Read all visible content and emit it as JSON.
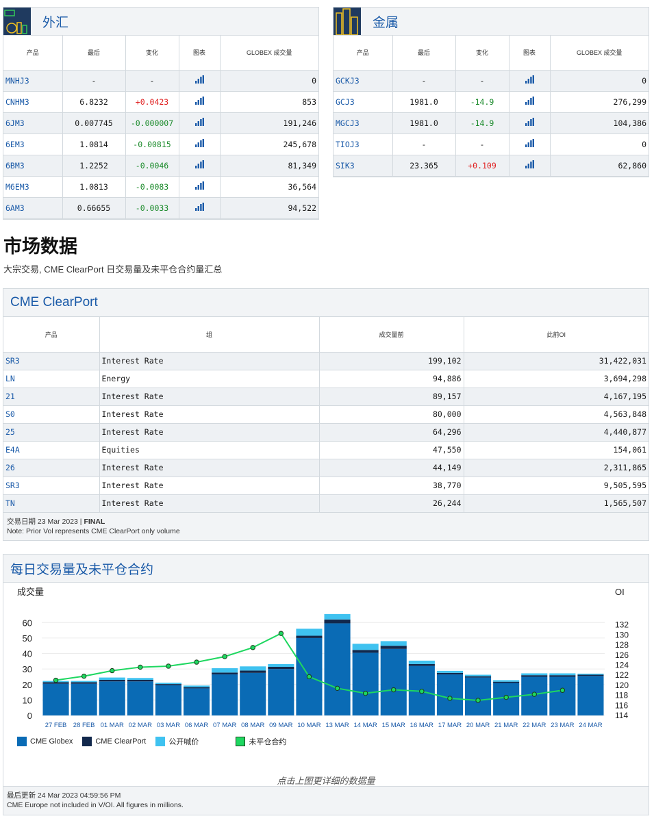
{
  "fx": {
    "title": "外汇",
    "headers": [
      "产品",
      "最后",
      "变化",
      "图表",
      "GLOBEX 成交量"
    ],
    "rows": [
      {
        "sym": "MNHJ3",
        "last": "-",
        "chg": "-",
        "dir": "none",
        "vol": "0"
      },
      {
        "sym": "CNHM3",
        "last": "6.8232",
        "chg": "+0.0423",
        "dir": "pos",
        "vol": "853"
      },
      {
        "sym": "6JM3",
        "last": "0.007745",
        "chg": "-0.000007",
        "dir": "neg",
        "vol": "191,246"
      },
      {
        "sym": "6EM3",
        "last": "1.0814",
        "chg": "-0.00815",
        "dir": "neg",
        "vol": "245,678"
      },
      {
        "sym": "6BM3",
        "last": "1.2252",
        "chg": "-0.0046",
        "dir": "neg",
        "vol": "81,349"
      },
      {
        "sym": "M6EM3",
        "last": "1.0813",
        "chg": "-0.0083",
        "dir": "neg",
        "vol": "36,564"
      },
      {
        "sym": "6AM3",
        "last": "0.66655",
        "chg": "-0.0033",
        "dir": "neg",
        "vol": "94,522"
      }
    ]
  },
  "metals": {
    "title": "金属",
    "headers": [
      "产品",
      "最后",
      "变化",
      "图表",
      "GLOBEX 成交量"
    ],
    "rows": [
      {
        "sym": "GCKJ3",
        "last": "-",
        "chg": "-",
        "dir": "none",
        "vol": "0"
      },
      {
        "sym": "GCJ3",
        "last": "1981.0",
        "chg": "-14.9",
        "dir": "neg",
        "vol": "276,299"
      },
      {
        "sym": "MGCJ3",
        "last": "1981.0",
        "chg": "-14.9",
        "dir": "neg",
        "vol": "104,386"
      },
      {
        "sym": "TIOJ3",
        "last": "-",
        "chg": "-",
        "dir": "none",
        "vol": "0"
      },
      {
        "sym": "SIK3",
        "last": "23.365",
        "chg": "+0.109",
        "dir": "pos",
        "vol": "62,860"
      }
    ]
  },
  "market": {
    "title": "市场数据",
    "subtitle": "大宗交易, CME ClearPort 日交易量及未平仓合约量汇总"
  },
  "clearport": {
    "title": "CME ClearPort",
    "headers": [
      "产品",
      "组",
      "成交量前",
      "此前OI"
    ],
    "rows": [
      {
        "sym": "SR3",
        "group": "Interest Rate",
        "vol": "199,102",
        "oi": "31,422,031"
      },
      {
        "sym": "LN",
        "group": "Energy",
        "vol": "94,886",
        "oi": "3,694,298"
      },
      {
        "sym": "21",
        "group": "Interest Rate",
        "vol": "89,157",
        "oi": "4,167,195"
      },
      {
        "sym": "S0",
        "group": "Interest Rate",
        "vol": "80,000",
        "oi": "4,563,848"
      },
      {
        "sym": "25",
        "group": "Interest Rate",
        "vol": "64,296",
        "oi": "4,440,877"
      },
      {
        "sym": "E4A",
        "group": "Equities",
        "vol": "47,550",
        "oi": "154,061"
      },
      {
        "sym": "26",
        "group": "Interest Rate",
        "vol": "44,149",
        "oi": "2,311,865"
      },
      {
        "sym": "SR3",
        "group": "Interest Rate",
        "vol": "38,770",
        "oi": "9,505,595"
      },
      {
        "sym": "TN",
        "group": "Interest Rate",
        "vol": "26,244",
        "oi": "1,565,507"
      }
    ],
    "foot_date_prefix": "交易日期 23 Mar 2023 | ",
    "foot_status": "FINAL",
    "foot_note": "Note: Prior Vol represents CME ClearPort only volume"
  },
  "daily": {
    "title": "每日交易量及未平仓合约",
    "hint": "点击上图更详细的数据量",
    "foot_updated": "最后更新 24 Mar 2023 04:59:56 PM",
    "foot_note": "CME Europe not included in V/OI. All figures in millions."
  },
  "colors": {
    "globex": "#0a6bb5",
    "clearport": "#12284c",
    "openoutcry": "#3fc2f0",
    "oi": "#1ed760",
    "link": "#1a5aa8",
    "pos": "#e02020",
    "neg": "#1a8a2a"
  },
  "chart_data": {
    "type": "bar",
    "stacked": true,
    "ylabel": "成交量",
    "y2label": "OI",
    "ylim": [
      0,
      65
    ],
    "yticks": [
      0,
      10,
      20,
      30,
      40,
      50,
      60
    ],
    "y2lim": [
      114,
      134
    ],
    "y2ticks": [
      114,
      116,
      118,
      120,
      122,
      124,
      126,
      128,
      130,
      132
    ],
    "categories": [
      "27 FEB",
      "28 FEB",
      "01 MAR",
      "02 MAR",
      "03 MAR",
      "06 MAR",
      "07 MAR",
      "08 MAR",
      "09 MAR",
      "10 MAR",
      "13 MAR",
      "14 MAR",
      "15 MAR",
      "16 MAR",
      "17 MAR",
      "20 MAR",
      "21 MAR",
      "22 MAR",
      "23 MAR",
      "24 MAR"
    ],
    "series": [
      {
        "name": "CME Globex",
        "values": [
          20.5,
          20.5,
          22.0,
          22.0,
          19.5,
          17.5,
          26.5,
          27.5,
          30.0,
          50.0,
          59.5,
          40.5,
          43.0,
          32.0,
          26.5,
          24.5,
          21.0,
          25.0,
          25.0,
          25.5
        ]
      },
      {
        "name": "CME ClearPort",
        "values": [
          1.0,
          1.0,
          1.0,
          1.0,
          0.8,
          0.8,
          1.2,
          1.5,
          1.4,
          1.5,
          2.5,
          1.8,
          2.0,
          1.2,
          1.0,
          0.8,
          0.8,
          1.0,
          1.0,
          0.8
        ]
      },
      {
        "name": "公开喊价",
        "values": [
          0.8,
          0.8,
          1.5,
          1.2,
          0.8,
          1.0,
          2.8,
          2.7,
          1.8,
          4.5,
          3.5,
          4.0,
          3.0,
          2.2,
          1.3,
          1.0,
          1.0,
          1.2,
          1.2,
          0.7
        ]
      },
      {
        "name": "未平仓合约",
        "axis": "right",
        "type": "line",
        "values": [
          121.0,
          121.8,
          122.9,
          123.6,
          123.8,
          124.6,
          125.7,
          127.5,
          130.3,
          121.7,
          119.4,
          118.4,
          119.1,
          118.8,
          117.4,
          117.0,
          117.6,
          118.2,
          119.0,
          null
        ]
      }
    ]
  }
}
